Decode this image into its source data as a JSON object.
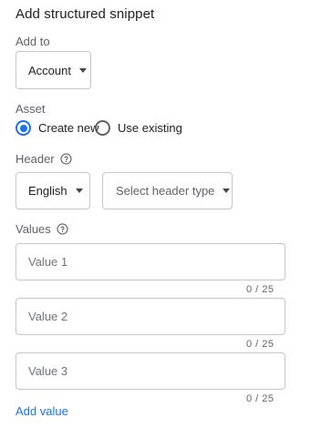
{
  "title": "Add structured snippet",
  "add_to": {
    "label": "Add to",
    "selected": "Account"
  },
  "asset": {
    "label": "Asset",
    "options": [
      {
        "label": "Create new",
        "checked": true
      },
      {
        "label": "Use existing",
        "checked": false
      }
    ]
  },
  "header": {
    "label": "Header",
    "language": "English",
    "type_placeholder": "Select header type"
  },
  "values": {
    "label": "Values",
    "fields": [
      {
        "placeholder": "Value 1",
        "value": "",
        "counter": "0 / 25"
      },
      {
        "placeholder": "Value 2",
        "value": "",
        "counter": "0 / 25"
      },
      {
        "placeholder": "Value 3",
        "value": "",
        "counter": "0 / 25"
      }
    ]
  },
  "add_value_label": "Add value",
  "colors": {
    "accent": "#1a73e8",
    "text": "#202124",
    "secondary": "#5f6368",
    "border": "#c4c7c5"
  }
}
